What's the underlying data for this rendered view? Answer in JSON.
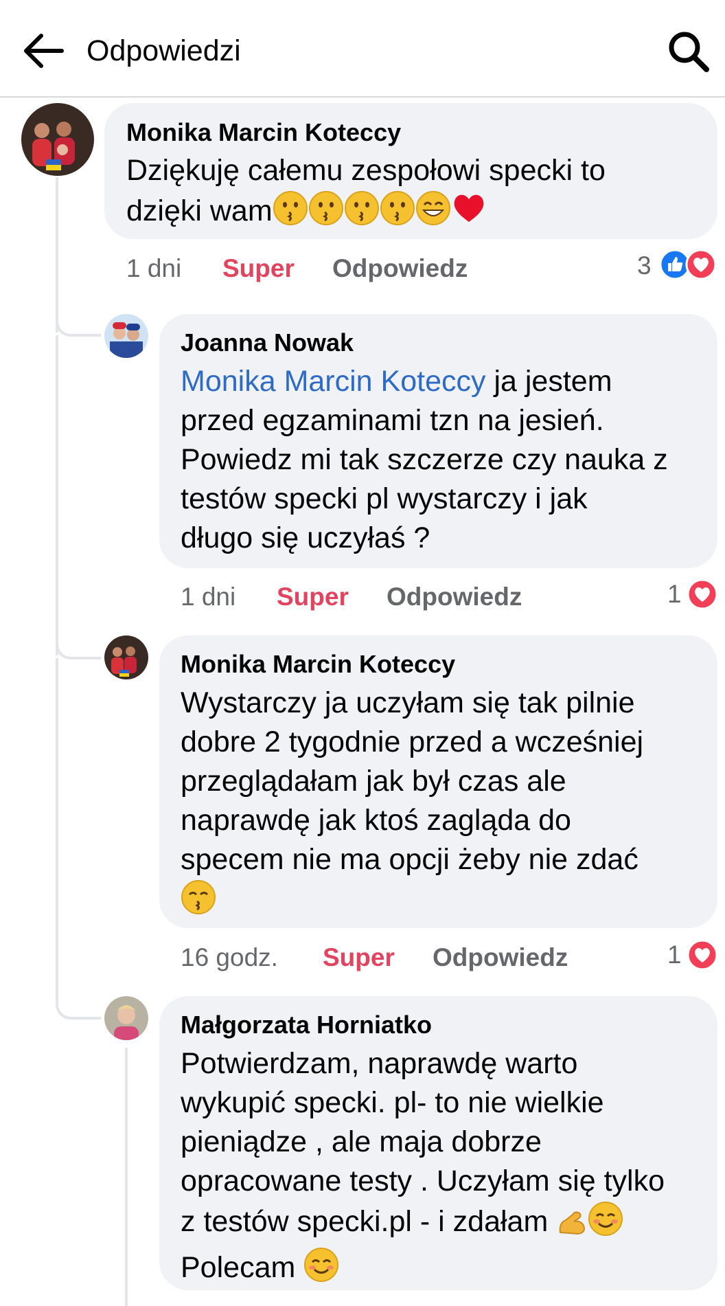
{
  "header": {
    "title": "Odpowiedzi"
  },
  "comments": [
    {
      "author": "Monika Marcin Koteccy",
      "text_lines": [
        "Dziękuję całemu zespołowi specki to",
        "dzięki wam"
      ],
      "emojis": [
        "kissing-face",
        "kissing-face",
        "kissing-face",
        "kissing-face",
        "grinning-face",
        "red-heart"
      ],
      "time": "1 dni",
      "like_label": "Super",
      "reply_label": "Odpowiedz",
      "reaction_count": "3",
      "reactions": [
        "like",
        "love"
      ]
    },
    {
      "author": "Joanna Nowak",
      "mention": "Monika Marcin Koteccy",
      "text_lines": [
        " ja jestem",
        "przed egzaminami tzn na jesień.",
        "Powiedz mi tak szczerze czy nauka z",
        "testów specki pl wystarczy i jak",
        "długo się uczyłaś ?"
      ],
      "time": "1 dni",
      "like_label": "Super",
      "reply_label": "Odpowiedz",
      "reaction_count": "1",
      "reactions": [
        "love"
      ]
    },
    {
      "author": "Monika Marcin Koteccy",
      "text_lines": [
        "Wystarczy ja uczyłam się tak pilnie",
        "dobre 2 tygodnie przed a wcześniej",
        "przeglądałam jak był czas ale",
        "naprawdę  jak ktoś zagląda do",
        "specem nie ma opcji żeby nie zdać"
      ],
      "emojis": [
        "kissing-smiling-eyes"
      ],
      "time": "16 godz.",
      "like_label": "Super",
      "reply_label": "Odpowiedz",
      "reaction_count": "1",
      "reactions": [
        "love"
      ]
    },
    {
      "author": "Małgorzata Horniatko",
      "text_lines": [
        "Potwierdzam, naprawdę warto",
        "wykupić specki. pl- to nie wielkie",
        "pieniądze , ale maja dobrze",
        "opracowane testy . Uczyłam się tylko",
        "z testów specki.pl - i zdałam ",
        "Polecam "
      ],
      "emojis": [
        "flexed-biceps",
        "smiling-face",
        "smiling-face"
      ]
    }
  ],
  "colors": {
    "super": "#e44360",
    "mention": "#2d6bc7",
    "bubble": "#f0f2f5",
    "like_blue": "#1877f2",
    "love_red": "#f33e58"
  }
}
